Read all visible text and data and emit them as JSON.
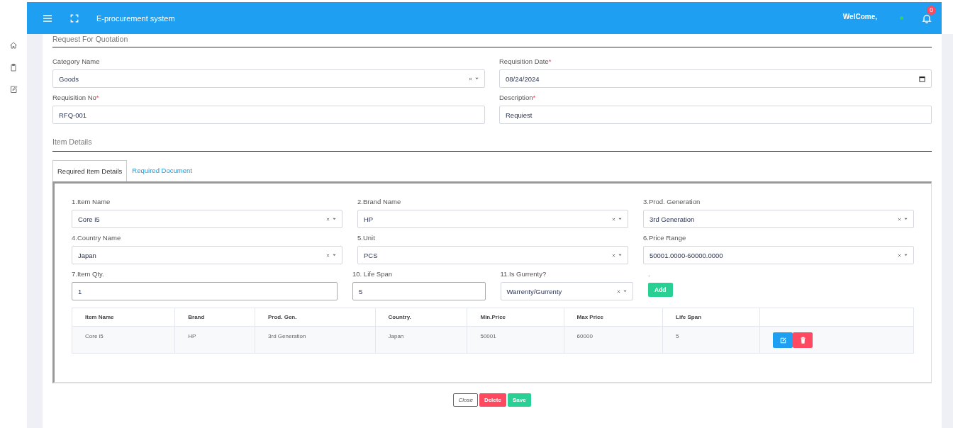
{
  "app": {
    "title": "E-procurement system",
    "welcome": "WelCome,",
    "user_online": true,
    "notification_count": "0"
  },
  "section_title": "Request For Quotation",
  "fields": [
    {
      "label": "Category Name",
      "kind": "select",
      "value": "Goods"
    },
    {
      "label": "Requisition Date",
      "mark": "*",
      "kind": "date",
      "value": "08/24/2024"
    },
    {
      "label": "Requisition No",
      "mark": "*",
      "kind": "text",
      "value": "RFQ-001"
    },
    {
      "label": "Description",
      "mark": "*",
      "kind": "text",
      "value": "Requiest"
    }
  ],
  "item_section_title": "Item Details",
  "tabs": [
    {
      "label": "Required Item Details",
      "selected": true
    },
    {
      "label": "Required Document",
      "selected": false
    }
  ],
  "item_rows": [
    [
      {
        "label": "1.Item Name",
        "kind": "select",
        "value": "Core i5"
      },
      {
        "label": "2.Brand Name",
        "kind": "select",
        "value": "HP"
      },
      {
        "label": "3.Prod. Generation",
        "kind": "select",
        "value": "3rd Generation"
      }
    ],
    [
      {
        "label": "4.Country Name",
        "kind": "select",
        "value": "Japan"
      },
      {
        "label": "5.Unit",
        "kind": "select",
        "value": "PCS"
      },
      {
        "label": "6.Price Range",
        "kind": "select",
        "value": "50001.0000-60000.0000"
      }
    ],
    [
      {
        "label": "7.Item Qty.",
        "kind": "text",
        "value": "1"
      },
      {
        "label": "10. Life Span",
        "kind": "text",
        "value": "5"
      },
      {
        "label": "11.Is Gurrenty?",
        "kind": "select",
        "value": "Warrenty/Gurrenty"
      },
      {
        "label": ".",
        "kind": "button",
        "value": "Add"
      }
    ]
  ],
  "table": {
    "columns": [
      "Item Name",
      "Brand",
      "Prod. Gen.",
      "Country.",
      "Min.Price",
      "Max Price",
      "Life Span"
    ],
    "rows": [
      {
        "cells": [
          "Core i5",
          "HP",
          "3rd Generation",
          "Japan",
          "50001",
          "60000",
          "5"
        ]
      }
    ]
  },
  "footer_buttons": [
    {
      "label": "Close",
      "kind": "outline"
    },
    {
      "label": "Delete",
      "kind": "danger"
    },
    {
      "label": "Save",
      "kind": "success"
    }
  ]
}
